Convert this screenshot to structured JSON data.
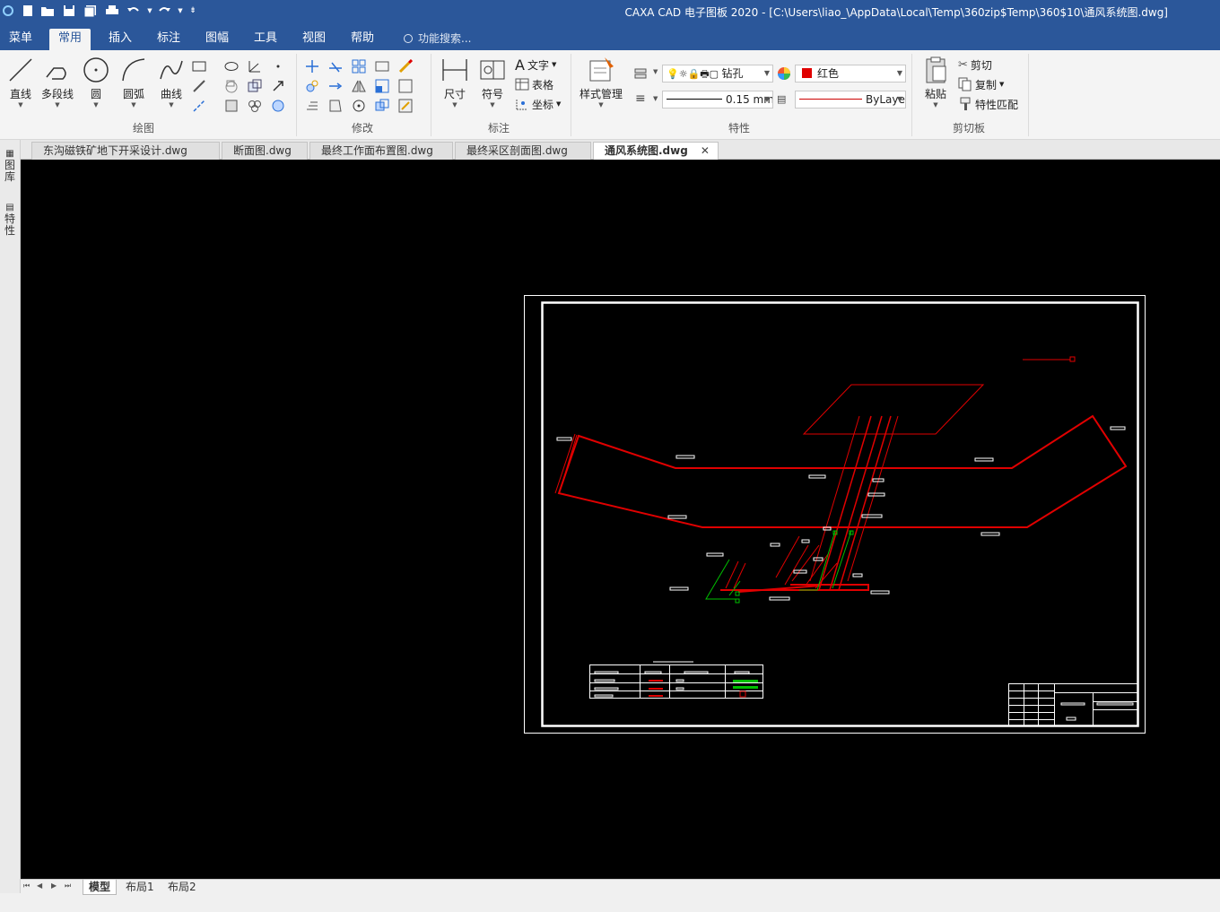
{
  "window": {
    "title": "CAXA CAD 电子图板 2020 - [C:\\Users\\liao_\\AppData\\Local\\Temp\\360zip$Temp\\360$10\\通风系统图.dwg]"
  },
  "quick_access": [
    "app-logo-icon",
    "new-file-icon",
    "open-folder-icon",
    "save-icon",
    "save-all-icon",
    "print-icon",
    "undo-icon",
    "redo-icon",
    "customize-icon"
  ],
  "menu": {
    "tabs": [
      "菜单",
      "常用",
      "插入",
      "标注",
      "图幅",
      "工具",
      "视图",
      "帮助"
    ],
    "active": "常用",
    "search_placeholder": "功能搜索..."
  },
  "ribbon": {
    "draw": {
      "label": "绘图",
      "line": "直线",
      "polyline": "多段线",
      "circle": "圆",
      "arc": "圆弧",
      "curve": "曲线"
    },
    "modify": {
      "label": "修改"
    },
    "annotate": {
      "label": "标注",
      "dimension": "尺寸",
      "symbol": "符号",
      "text": "文字",
      "table": "表格",
      "coordinate": "坐标"
    },
    "properties": {
      "label": "特性",
      "style_manager": "样式管理",
      "layer": "钻孔",
      "color": "红色",
      "color_swatch": "#e00000",
      "lineweight": "0.15 mm",
      "linetype": "ByLayer"
    },
    "clipboard": {
      "label": "剪切板",
      "paste": "粘贴",
      "cut": "剪切",
      "copy": "复制",
      "match": "特性匹配"
    }
  },
  "left_dock": [
    "图库",
    "特性"
  ],
  "doc_tabs": [
    {
      "label": "东沟磁铁矿地下开采设计.dwg"
    },
    {
      "label": "断面图.dwg"
    },
    {
      "label": "最终工作面布置图.dwg"
    },
    {
      "label": "最终采区剖面图.dwg"
    },
    {
      "label": "通风系统图.dwg",
      "active": true
    }
  ],
  "layout_tabs": [
    "模型",
    "布局1",
    "布局2"
  ],
  "colors": {
    "accent": "#2b579a",
    "canvas": "#000000",
    "drawing_red": "#e00000",
    "drawing_green": "#00c000"
  }
}
